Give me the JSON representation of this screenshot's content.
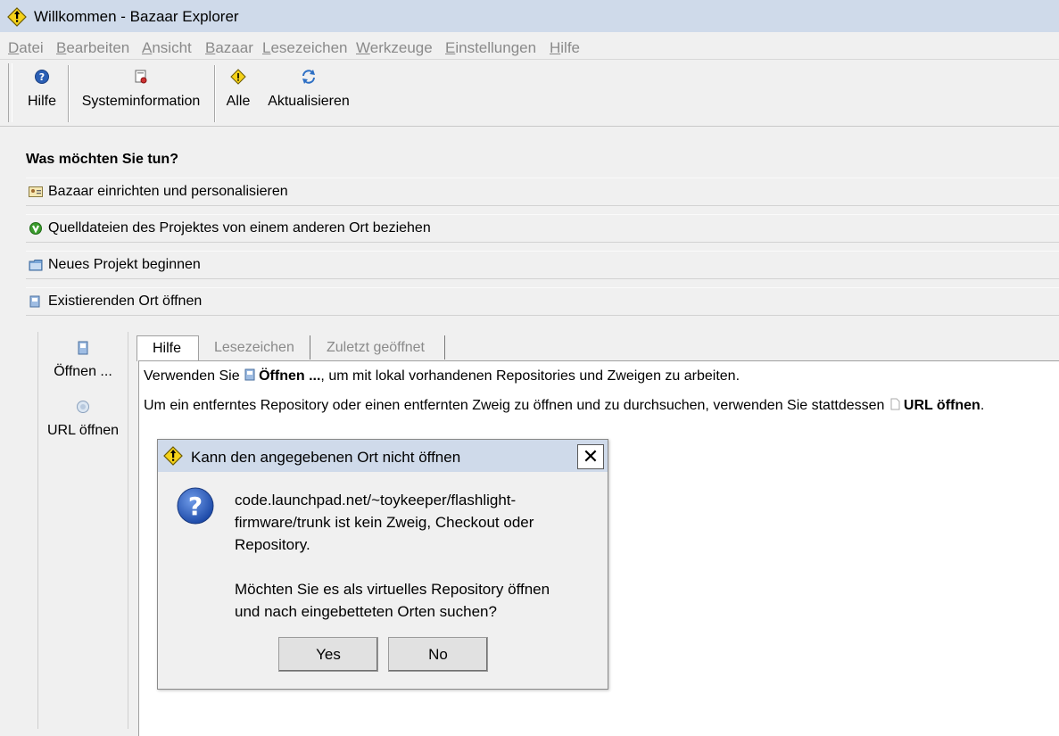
{
  "window": {
    "title": "Willkommen - Bazaar Explorer"
  },
  "menu": {
    "items": [
      {
        "first": "D",
        "rest": "atei"
      },
      {
        "first": "B",
        "rest": "earbeiten"
      },
      {
        "first": "A",
        "rest": "nsicht"
      },
      {
        "first": "B",
        "rest": "azaar"
      },
      {
        "first": "L",
        "rest": "esezeichen"
      },
      {
        "first": "W",
        "rest": "erkzeuge"
      },
      {
        "first": "E",
        "rest": "instellungen"
      },
      {
        "first": "H",
        "rest": "ilfe"
      }
    ]
  },
  "toolbar": {
    "help_label": "Hilfe",
    "sysinfo_label": "Systeminformation",
    "all_label": "Alle",
    "refresh_label": "Aktualisieren"
  },
  "main": {
    "question": "Was möchten Sie tun?",
    "actions": [
      {
        "label": "Bazaar einrichten und personalisieren"
      },
      {
        "label": "Quelldateien des Projektes von einem anderen Ort beziehen"
      },
      {
        "label": "Neues Projekt beginnen"
      },
      {
        "label": "Existierenden Ort öffnen"
      }
    ]
  },
  "leftpane": {
    "open_label": "Öffnen ...",
    "open_url_label": "URL öffnen"
  },
  "tabs": [
    "Hilfe",
    "Lesezeichen",
    "Zuletzt geöffnet"
  ],
  "help": {
    "line1_pre": "Verwenden Sie",
    "line1_bold": "Öffnen ...",
    "line1_post": ", um mit lokal vorhandenen Repositories und Zweigen zu arbeiten.",
    "line2_pre": "Um ein entferntes Repository oder einen entfernten Zweig zu öffnen und zu durchsuchen, verwenden Sie stattdessen",
    "line2_bold": "URL öffnen",
    "line2_post": "."
  },
  "dialog": {
    "title": "Kann den angegebenen Ort nicht öffnen",
    "message_lines": [
      "code.launchpad.net/~toykeeper/flashlight-",
      "firmware/trunk ist kein Zweig, Checkout oder",
      "Repository.",
      "Möchten Sie es als virtuelles Repository öffnen",
      "und nach eingebetteten Orten suchen?"
    ],
    "yes_label": "Yes",
    "no_label": "No",
    "close_glyph": "✕"
  },
  "colors": {
    "titlebar": "#cfdaea",
    "window_bg": "#f0f0f0",
    "disabled_text": "#8a8a8a",
    "bazaar_yellow": "#f5d21a"
  }
}
